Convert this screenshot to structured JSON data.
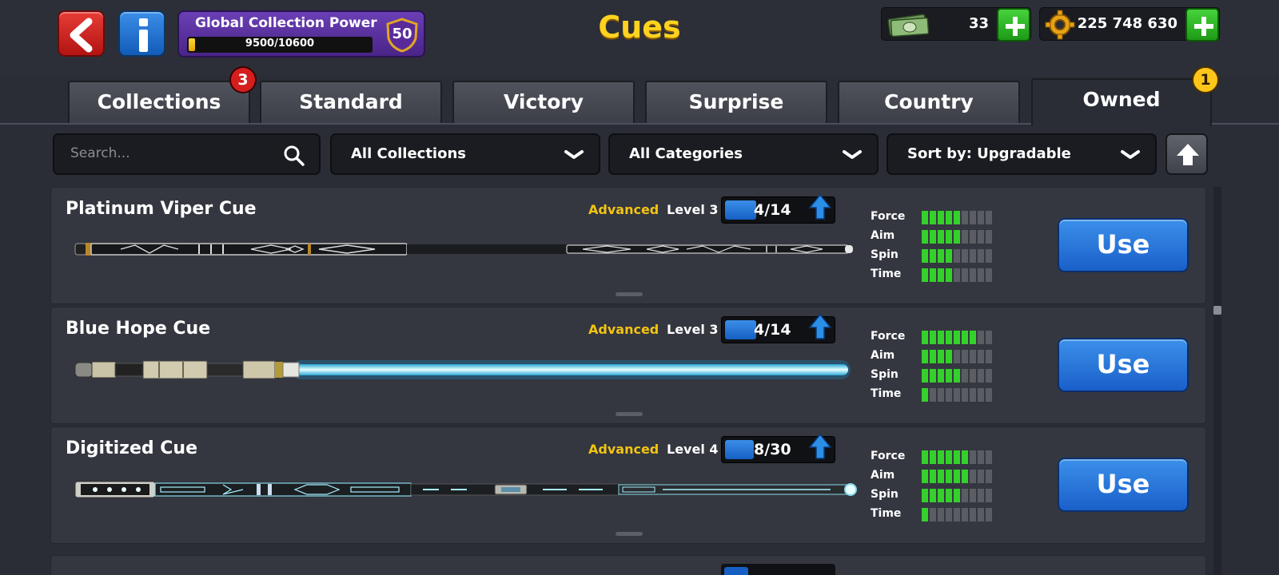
{
  "header": {
    "title": "Cues",
    "collection_power": {
      "label": "Global Collection Power",
      "progress_text": "9500/10600",
      "progress_fraction": 0.03,
      "level": "50"
    },
    "cash": {
      "value": "33",
      "icon": "cash-bundle-icon"
    },
    "coins": {
      "value": "225 748 630",
      "icon": "coin-icon"
    }
  },
  "tabs": [
    {
      "label": "Collections",
      "badge": "3"
    },
    {
      "label": "Standard"
    },
    {
      "label": "Victory"
    },
    {
      "label": "Surprise"
    },
    {
      "label": "Country"
    },
    {
      "label": "Owned",
      "badge": "1",
      "active": true
    }
  ],
  "filters": {
    "search_placeholder": "Search...",
    "collection": "All Collections",
    "category": "All Categories",
    "sort": "Sort by: Upgradable"
  },
  "colors": {
    "accent_yellow": "#ffd21f",
    "rarity_advanced": "#f2c314",
    "stat_green": "#34d12a",
    "stat_empty": "#5a5d63",
    "use_button_blue": "#1a5fc9"
  },
  "cues": [
    {
      "name": "Platinum Viper Cue",
      "rarity": "Advanced",
      "level": "Level 3",
      "progress": "4/14",
      "progress_fraction": 0.286,
      "stats": {
        "Force": 5,
        "Aim": 5,
        "Spin": 4,
        "Time": 4
      },
      "stat_max": 10,
      "style": "platinum"
    },
    {
      "name": "Blue Hope Cue",
      "rarity": "Advanced",
      "level": "Level 3",
      "progress": "4/14",
      "progress_fraction": 0.286,
      "stats": {
        "Force": 7,
        "Aim": 4,
        "Spin": 5,
        "Time": 1
      },
      "stat_max": 10,
      "style": "lightsaber"
    },
    {
      "name": "Digitized Cue",
      "rarity": "Advanced",
      "level": "Level 4",
      "progress": "8/30",
      "progress_fraction": 0.267,
      "stats": {
        "Force": 6,
        "Aim": 6,
        "Spin": 5,
        "Time": 1
      },
      "stat_max": 10,
      "style": "digital"
    }
  ],
  "labels": {
    "use": "Use",
    "stat_names": [
      "Force",
      "Aim",
      "Spin",
      "Time"
    ]
  }
}
